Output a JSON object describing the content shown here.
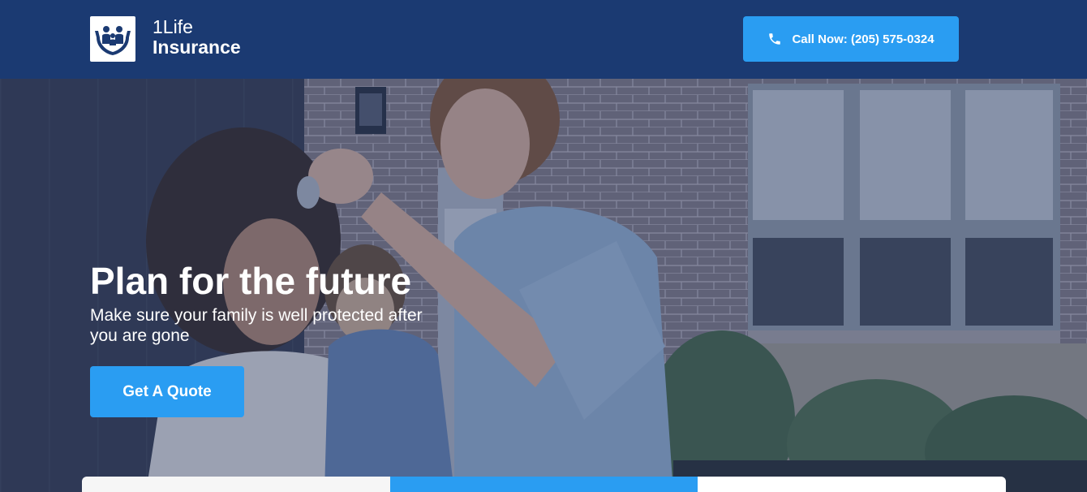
{
  "header": {
    "brand_line1": "1Life",
    "brand_line2": "Insurance",
    "logo_icon": "family-hands-icon",
    "call_label": "Call Now: (205) 575-0324",
    "call_icon": "phone-icon"
  },
  "hero": {
    "title": "Plan for the future",
    "subtitle": "Make sure your family is well protected after you are gone",
    "cta_label": "Get A Quote"
  },
  "colors": {
    "header_bg": "#1b3a72",
    "accent": "#2a9df2",
    "text_light": "#ffffff"
  }
}
